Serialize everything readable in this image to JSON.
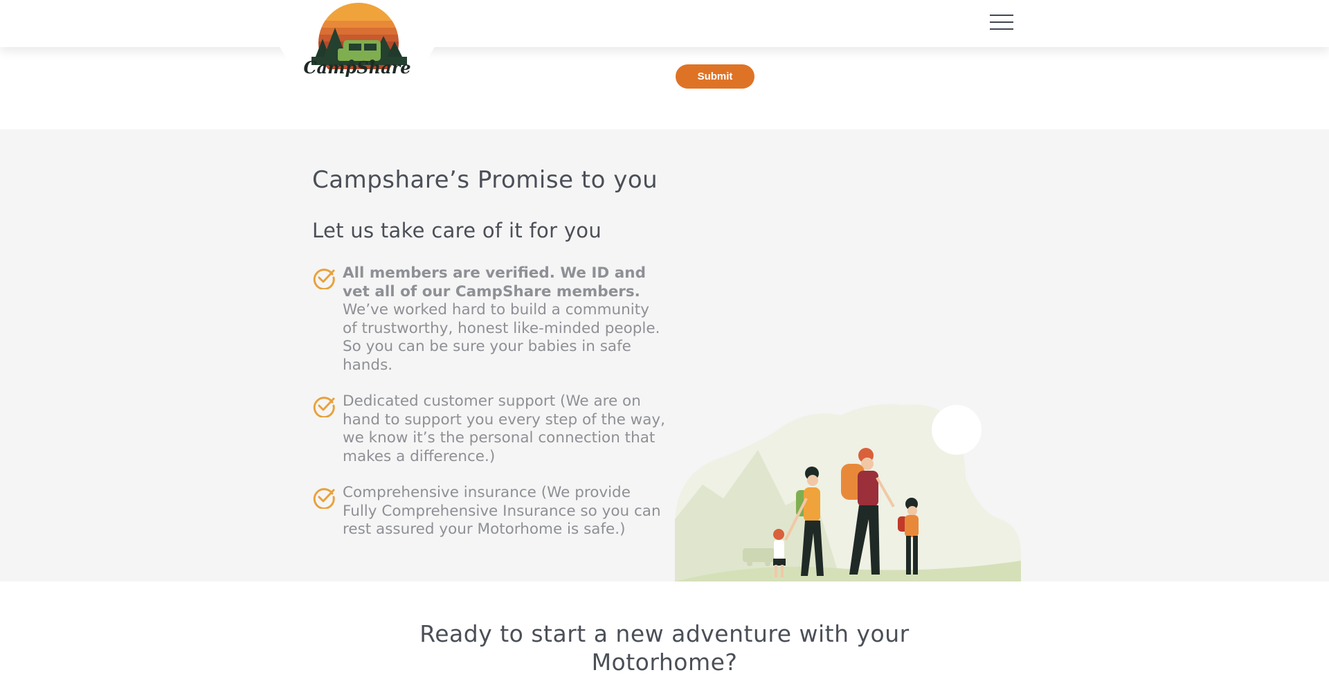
{
  "header": {
    "logo_text": "CampShare",
    "menu_icon": "hamburger-menu-icon"
  },
  "form": {
    "submit_label": "Submit"
  },
  "promise": {
    "title": "Campshare’s Promise to you",
    "subtitle": "Let us take care of it for you",
    "items": [
      {
        "bold": "All members are verified. We ID and vet all of our CampShare members.",
        "text": " We’ve worked hard to build a community of trustworthy, honest like-minded people. So you can be sure your babies in safe hands."
      },
      {
        "bold": "",
        "text": "Dedicated customer support (We are on hand to support you every step of the way, we know it’s the personal connection that makes a difference.)"
      },
      {
        "bold": "",
        "text": "Comprehensive insurance (We provide Fully Comprehensive Insurance so you can rest assured your Motorhome is safe.)"
      }
    ],
    "check_icon": "checkmark-circle-icon",
    "accent": "#e9a13b"
  },
  "cta": {
    "line1": "Ready to start a new adventure with your",
    "line2": "Motorhome?"
  },
  "colors": {
    "brand_orange": "#de7326",
    "section_bg": "#f5f5f5",
    "heading": "#4b4f57",
    "body_text": "#8e9095"
  }
}
